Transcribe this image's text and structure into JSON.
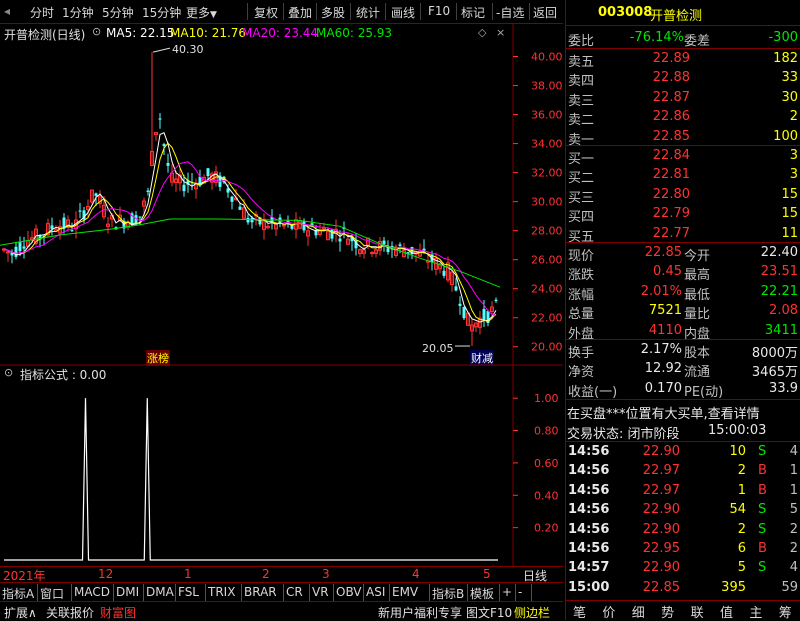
{
  "toolbar": {
    "left_items": [
      "分时",
      "1分钟",
      "5分钟",
      "15分钟",
      "更多"
    ],
    "right_items": [
      "复权",
      "叠加",
      "多股",
      "统计",
      "画线",
      "F10",
      "标记",
      "-自选",
      "返回"
    ]
  },
  "chart": {
    "title": "开普检测(日线)",
    "ma5_label": "MA5: 22.15",
    "ma10_label": "MA10: 21.76",
    "ma20_label": "MA20: 23.44",
    "ma60_label": "MA60: 25.93",
    "high_annotation": "40.30",
    "low_annotation": "20.05",
    "marker1": "涨榜",
    "marker2": "财减",
    "colors": {
      "ma5": "#ffffff",
      "ma10": "#ffff00",
      "ma20": "#ff00ff",
      "ma60": "#00e600",
      "up": "#ff3232",
      "down": "#54ffff",
      "axis": "#ff3232",
      "border": "#800000"
    }
  },
  "chart_data": [
    {
      "type": "candlestick",
      "ylim": [
        19.5,
        41
      ],
      "yticks": [
        20,
        22,
        24,
        26,
        28,
        30,
        32,
        34,
        36,
        38,
        40
      ],
      "x_labels": [
        "2021年",
        "12",
        "1",
        "2",
        "3",
        "4",
        "5"
      ],
      "series": [
        {
          "name": "MA5",
          "last": 22.15
        },
        {
          "name": "MA10",
          "last": 21.76
        },
        {
          "name": "MA20",
          "last": 23.44
        },
        {
          "name": "MA60",
          "last": 25.93
        }
      ],
      "high": 40.3,
      "low": 20.05
    },
    {
      "type": "line",
      "ylim": [
        0,
        1.1
      ],
      "yticks": [
        0.2,
        0.4,
        0.6,
        0.8,
        1.0
      ],
      "spikes_at_fraction": [
        0.165,
        0.29
      ]
    }
  ],
  "indicator": {
    "label": "指标公式 : 0.00"
  },
  "datebar": {
    "year": "2021年",
    "labels": [
      "12",
      "1",
      "2",
      "3",
      "4",
      "5"
    ],
    "period": "日线"
  },
  "tabs": [
    "指标A",
    "窗口",
    "MACD",
    "DMI",
    "DMA",
    "FSL",
    "TRIX",
    "BRAR",
    "CR",
    "VR",
    "OBV",
    "ASI",
    "EMV",
    "指标B",
    "模板",
    "+",
    "-"
  ],
  "bottom": {
    "expand": "扩展∧",
    "related": "关联报价",
    "wealth": "财富图",
    "promo": "新用户福利专享",
    "f10": "图文F10",
    "sidebar": "侧边栏"
  },
  "quote": {
    "code": "003008",
    "name": "开普检测",
    "weibi_label": "委比",
    "weibi": "-76.14%",
    "weicha_label": "委差",
    "weicha": "-300",
    "asks": [
      {
        "label": "卖五",
        "price": "22.89",
        "vol": "182"
      },
      {
        "label": "卖四",
        "price": "22.88",
        "vol": "33"
      },
      {
        "label": "卖三",
        "price": "22.87",
        "vol": "30"
      },
      {
        "label": "卖二",
        "price": "22.86",
        "vol": "2"
      },
      {
        "label": "卖一",
        "price": "22.85",
        "vol": "100"
      }
    ],
    "bids": [
      {
        "label": "买一",
        "price": "22.84",
        "vol": "3"
      },
      {
        "label": "买二",
        "price": "22.81",
        "vol": "3"
      },
      {
        "label": "买三",
        "price": "22.80",
        "vol": "15"
      },
      {
        "label": "买四",
        "price": "22.79",
        "vol": "15"
      },
      {
        "label": "买五",
        "price": "22.77",
        "vol": "11"
      }
    ],
    "stats": [
      {
        "l1": "现价",
        "v1": "22.85",
        "l2": "今开",
        "v2": "22.40",
        "c1": "red",
        "c2": "wht"
      },
      {
        "l1": "涨跌",
        "v1": "0.45",
        "l2": "最高",
        "v2": "23.51",
        "c1": "red",
        "c2": "red"
      },
      {
        "l1": "涨幅",
        "v1": "2.01%",
        "l2": "最低",
        "v2": "22.21",
        "c1": "red",
        "c2": "grn"
      },
      {
        "l1": "总量",
        "v1": "7521",
        "l2": "量比",
        "v2": "2.08",
        "c1": "yel",
        "c2": "red"
      },
      {
        "l1": "外盘",
        "v1": "4110",
        "l2": "内盘",
        "v2": "3411",
        "c1": "red",
        "c2": "grn"
      }
    ],
    "fin": [
      {
        "l1": "换手",
        "v1": "2.17%",
        "l2": "股本",
        "v2": "8000万"
      },
      {
        "l1": "净资",
        "v1": "12.92",
        "l2": "流通",
        "v2": "3465万"
      },
      {
        "l1": "收益(一)",
        "v1": "0.170",
        "l2": "PE(动)",
        "v2": "33.9"
      }
    ],
    "notice": "在买盘***位置有大买单,查看详情",
    "status_label": "交易状态: 闭市阶段",
    "status_time": "15:00:03",
    "ticks": [
      {
        "time": "14:56",
        "price": "22.90",
        "vol": "10",
        "bs": "S",
        "n": "4"
      },
      {
        "time": "14:56",
        "price": "22.97",
        "vol": "2",
        "bs": "B",
        "n": "1"
      },
      {
        "time": "14:56",
        "price": "22.97",
        "vol": "1",
        "bs": "B",
        "n": "1"
      },
      {
        "time": "14:56",
        "price": "22.90",
        "vol": "54",
        "bs": "S",
        "n": "5"
      },
      {
        "time": "14:56",
        "price": "22.90",
        "vol": "2",
        "bs": "S",
        "n": "2"
      },
      {
        "time": "14:56",
        "price": "22.95",
        "vol": "6",
        "bs": "B",
        "n": "2"
      },
      {
        "time": "14:57",
        "price": "22.90",
        "vol": "5",
        "bs": "S",
        "n": "4"
      },
      {
        "time": "15:00",
        "price": "22.85",
        "vol": "395",
        "bs": "",
        "n": "59"
      }
    ],
    "right_tabs": [
      "笔",
      "价",
      "细",
      "势",
      "联",
      "值",
      "主",
      "筹"
    ]
  }
}
